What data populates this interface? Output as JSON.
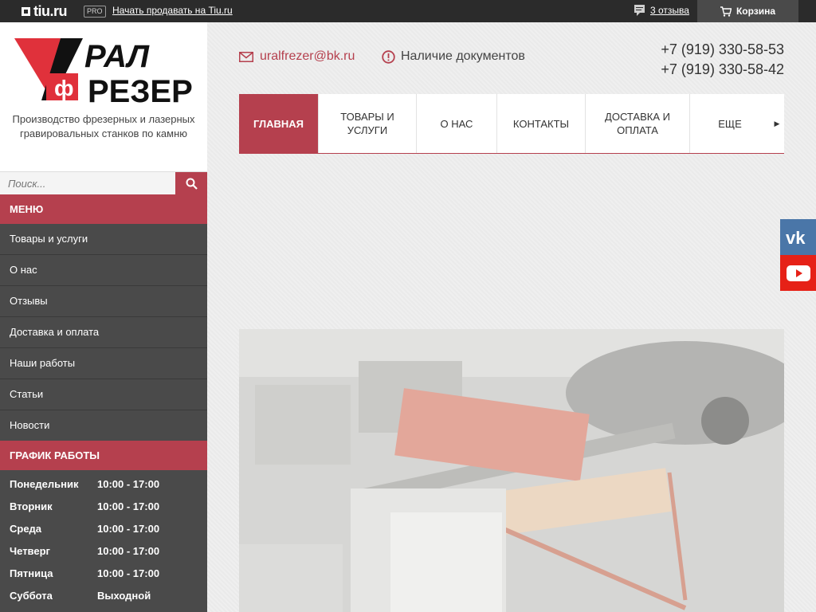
{
  "topbar": {
    "brand": "tiu.ru",
    "pro_badge": "PRO",
    "sell_link": "Начать продавать на Tiu.ru",
    "reviews_link": "3 отзыва",
    "cart_label": "Корзина"
  },
  "brand": {
    "tagline": "Производство фрезерных и лазерных гравировальных станков по камню",
    "logo_alt_text": "УРАЛ ФРЕЗЕР"
  },
  "search": {
    "placeholder": "Поиск..."
  },
  "sidebar": {
    "menu_title": "МЕНЮ",
    "menu_items": [
      "Товары и услуги",
      "О нас",
      "Отзывы",
      "Доставка и оплата",
      "Наши работы",
      "Статьи",
      "Новости"
    ],
    "schedule_title": "ГРАФИК РАБОТЫ",
    "schedule": [
      {
        "day": "Понедельник",
        "hours": "10:00 - 17:00"
      },
      {
        "day": "Вторник",
        "hours": "10:00 - 17:00"
      },
      {
        "day": "Среда",
        "hours": "10:00 - 17:00"
      },
      {
        "day": "Четверг",
        "hours": "10:00 - 17:00"
      },
      {
        "day": "Пятница",
        "hours": "10:00 - 17:00"
      },
      {
        "day": "Суббота",
        "hours": "Выходной"
      }
    ]
  },
  "contacts": {
    "email": "uralfrezer@bk.ru",
    "documents": "Наличие документов",
    "phone1": "+7 (919) 330-58-53",
    "phone2": "+7 (919) 330-58-42"
  },
  "nav": {
    "tabs": [
      "ГЛАВНАЯ",
      "ТОВАРЫ И УСЛУГИ",
      "О НАС",
      "КОНТАКТЫ",
      "ДОСТАВКА И ОПЛАТА",
      "ЕЩЕ"
    ]
  },
  "colors": {
    "accent": "#b5404e",
    "dark": "#2b2b2b",
    "sidebar": "#4a4a4a",
    "vk": "#4a76a8",
    "youtube": "#e62117"
  }
}
